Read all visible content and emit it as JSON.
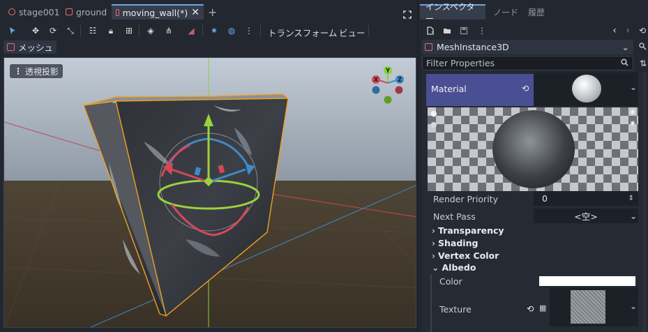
{
  "scene_tabs": [
    {
      "label": "stage001",
      "icon": "circle-node-icon",
      "active": false
    },
    {
      "label": "ground",
      "icon": "mesh-node-icon",
      "active": false
    },
    {
      "label": "moving_wall(*)",
      "icon": "mesh-node-icon",
      "active": true
    }
  ],
  "toolbar": {
    "transform_menu": "トランスフォーム",
    "view_menu": "ビュー"
  },
  "mesh_menu": "メッシュ",
  "viewport": {
    "perspective_label": "透視投影",
    "gizmo_axes": [
      "X",
      "Y",
      "Z"
    ]
  },
  "inspector": {
    "tabs": [
      "インスペクター",
      "ノード",
      "履歴"
    ],
    "node_name": "MeshInstance3D",
    "filter_placeholder": "Filter Properties",
    "material_label": "Material",
    "render_priority_label": "Render Priority",
    "render_priority_value": "0",
    "next_pass_label": "Next Pass",
    "next_pass_value": "<空>",
    "sections": [
      "Transparency",
      "Shading",
      "Vertex Color",
      "Albedo"
    ],
    "color_label": "Color",
    "texture_label": "Texture"
  },
  "colors": {
    "accent": "#6ea4e6",
    "material_row": "#4a4f93",
    "selection_outline": "#f0a020"
  }
}
